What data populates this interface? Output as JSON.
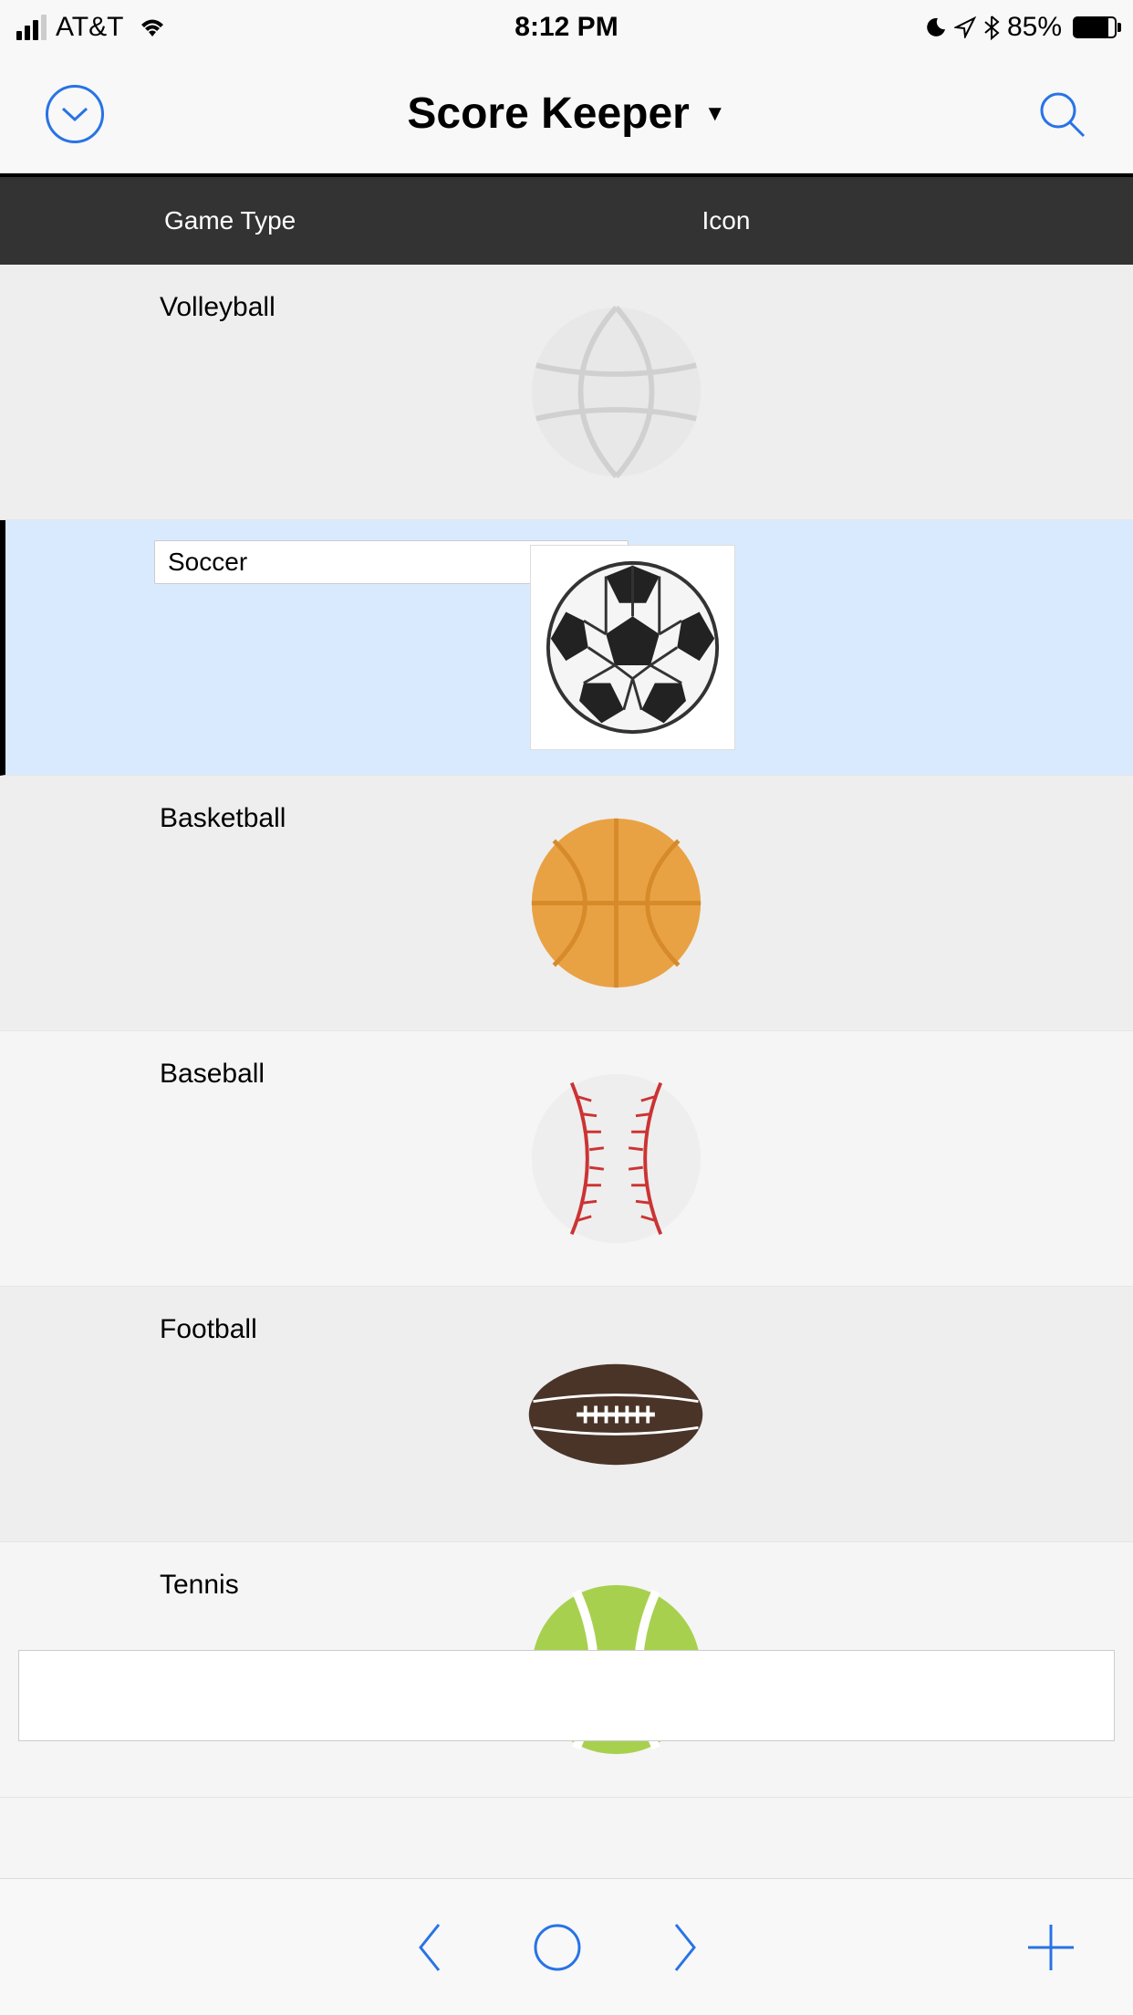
{
  "status": {
    "carrier": "AT&T",
    "time": "8:12 PM",
    "battery_pct": "85%"
  },
  "nav": {
    "title": "Score Keeper"
  },
  "table": {
    "headers": {
      "col1": "Game Type",
      "col2": "Icon"
    },
    "rows": [
      {
        "label": "Volleyball",
        "icon": "volleyball",
        "selected": false
      },
      {
        "label": "Soccer",
        "icon": "soccer",
        "selected": true
      },
      {
        "label": "Basketball",
        "icon": "basketball",
        "selected": false
      },
      {
        "label": "Baseball",
        "icon": "baseball",
        "selected": false
      },
      {
        "label": "Football",
        "icon": "football",
        "selected": false
      },
      {
        "label": "Tennis",
        "icon": "tennis",
        "selected": false
      }
    ]
  }
}
